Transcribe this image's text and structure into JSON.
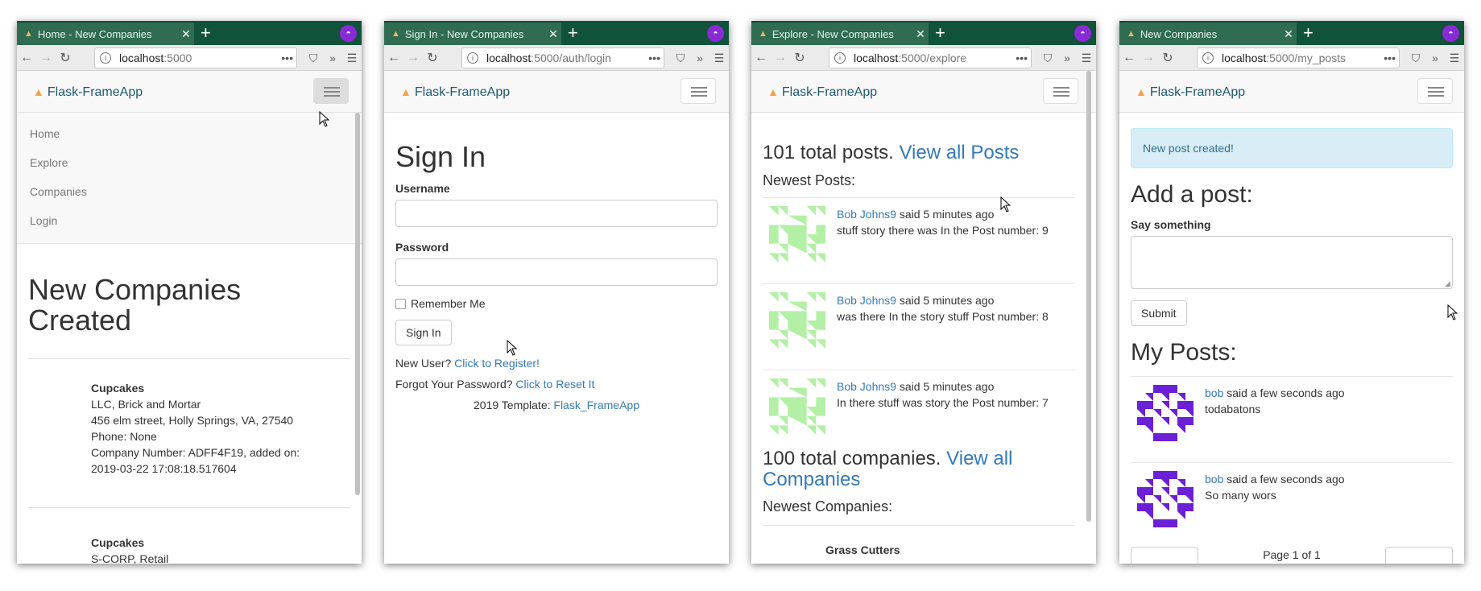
{
  "windows": [
    {
      "tab_title": "Home - New Companies",
      "url_host": "localhost",
      "url_path": ":5000",
      "brand": "Flask-FrameApp",
      "menu": [
        "Home",
        "Explore",
        "Companies",
        "Login"
      ],
      "heading": "New Companies Created",
      "companies": [
        {
          "name": "Cupcakes",
          "lines": [
            "LLC, Brick and Mortar",
            "456 elm street, Holly Springs, VA, 27540",
            "Phone: None",
            "Company Number: ADFF4F19, added on:",
            "2019-03-22 17:08:18.517604"
          ]
        },
        {
          "name": "Cupcakes",
          "lines": [
            "S-CORP, Retail"
          ]
        }
      ]
    },
    {
      "tab_title": "Sign In - New Companies",
      "url_host": "localhost",
      "url_path": ":5000/auth/login",
      "brand": "Flask-FrameApp",
      "heading": "Sign In",
      "username_label": "Username",
      "password_label": "Password",
      "remember_label": "Remember Me",
      "signin_button": "Sign In",
      "new_user_text": "New User?",
      "register_link": "Click to Register!",
      "forgot_text": "Forgot Your Password?",
      "reset_link": "Click to Reset It",
      "template_text": "2019 Template:",
      "template_link": "Flask_FrameApp"
    },
    {
      "tab_title": "Explore - New Companies",
      "url_host": "localhost",
      "url_path": ":5000/explore",
      "brand": "Flask-FrameApp",
      "posts_count_text": "101 total posts.",
      "view_posts_link": "View all Posts",
      "newest_posts_label": "Newest Posts:",
      "posts": [
        {
          "author": "Bob Johns9",
          "meta": "said 5 minutes ago",
          "body": "stuff story there was In the Post number: 9"
        },
        {
          "author": "Bob Johns9",
          "meta": "said 5 minutes ago",
          "body": "was there In the story stuff Post number: 8"
        },
        {
          "author": "Bob Johns9",
          "meta": "said 5 minutes ago",
          "body": "In there stuff was story the Post number: 7"
        }
      ],
      "companies_count_text": "100 total companies.",
      "view_companies_link": "View all Companies",
      "newest_companies_label": "Newest Companies:",
      "first_company": "Grass Cutters"
    },
    {
      "tab_title": "New Companies",
      "url_host": "localhost",
      "url_path": ":5000/my_posts",
      "brand": "Flask-FrameApp",
      "flash": "New post created!",
      "add_heading": "Add a post:",
      "say_label": "Say something",
      "submit_button": "Submit",
      "my_posts_heading": "My Posts:",
      "posts": [
        {
          "author": "bob",
          "meta": "said a few seconds ago",
          "body": "todabatons"
        },
        {
          "author": "bob",
          "meta": "said a few seconds ago",
          "body": "So many wors"
        }
      ],
      "pager_text": "Page 1 of 1"
    }
  ],
  "colors": {
    "tab_bar": "#11523a",
    "link": "#337ab7",
    "flash_bg": "#d9edf7",
    "avatar_green": "#b3f0a6",
    "avatar_purple": "#6b1fd6"
  }
}
